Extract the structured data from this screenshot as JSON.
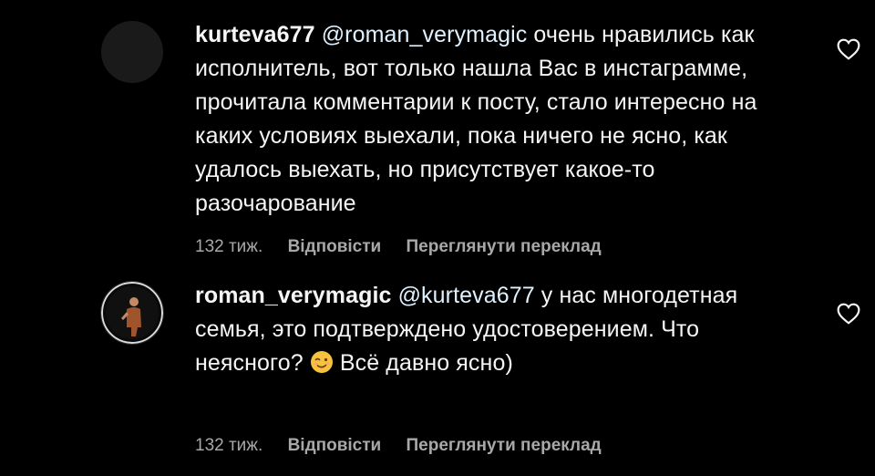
{
  "comments": [
    {
      "username": "kurteva677",
      "mention": "@roman_verymagic",
      "text_line1": "очень нравились",
      "text_rest": "как исполнитель, вот только нашла Вас в инстаграмме, прочитала комментарии к посту, стало интересно на каких условиях выехали, пока ничего не ясно, как удалось выехать, но присутствует какое-то разочарование",
      "time": "132 тиж.",
      "reply_label": "Відповісти",
      "translate_label": "Переглянути переклад"
    },
    {
      "username": "roman_verymagic",
      "mention": "@kurteva677",
      "text_before_emoji": "у нас многодетная семья, это подтверждено удостоверением. Что неясного?",
      "text_after_emoji": "Всё давно ясно)",
      "time": "132 тиж.",
      "reply_label": "Відповісти",
      "translate_label": "Переглянути переклад"
    }
  ],
  "colors": {
    "background": "#000000",
    "text": "#f5f5f5",
    "mention": "#e0f1ff",
    "meta": "#a8a8a8"
  },
  "icons": {
    "like": "heart-outline-icon",
    "wink": "winking-face-emoji"
  }
}
